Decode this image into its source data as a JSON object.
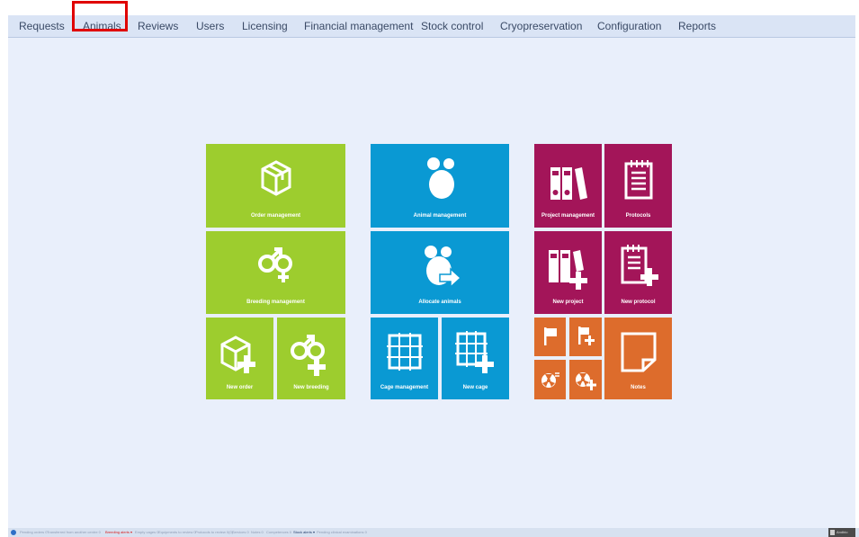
{
  "menu": {
    "items": [
      {
        "label": "Requests"
      },
      {
        "label": "Animals"
      },
      {
        "label": "Reviews"
      },
      {
        "label": "Users"
      },
      {
        "label": "Licensing"
      },
      {
        "label": "Financial management"
      },
      {
        "label": "Stock control"
      },
      {
        "label": "Cryopreservation"
      },
      {
        "label": "Configuration"
      },
      {
        "label": "Reports"
      }
    ],
    "highlighted": "Animals"
  },
  "tiles": {
    "order_management": "Order management",
    "breeding_management": "Breeding management",
    "new_order": "New order",
    "new_breeding": "New breeding",
    "animal_management": "Animal management",
    "allocate_animals": "Allocate animals",
    "cage_management": "Cage management",
    "new_cage": "New cage",
    "project_management": "Project management",
    "protocols": "Protocols",
    "new_project": "New project",
    "new_protocol": "New protocol",
    "notes": "Notes"
  },
  "colors": {
    "green": "#9dcd2e",
    "blue": "#0a99d3",
    "purple": "#a31559",
    "orange": "#dd6c2c",
    "highlight": "#e00000"
  },
  "status": {
    "pending_orders": "Pending orders 0",
    "transferred": "Transferred from another centre 0",
    "breeding_alerts": "Breeding alerts ▾",
    "empty_cages": "Empty cages 0",
    "equipments": "Equipments to review 0",
    "protocols_review": "Protocols to review 0(0)",
    "services": "Services 0",
    "notes": "Notes 0",
    "competences": "Competences 0",
    "stock_alerts": "Stock alerts ▾",
    "pending_exams": "Pending clinical examinations 0",
    "user": "Andbio"
  }
}
